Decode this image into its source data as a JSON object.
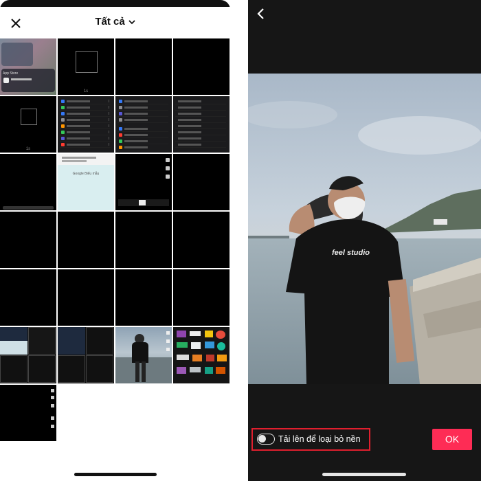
{
  "picker": {
    "title": "Tất cả",
    "close_icon": "close-icon",
    "dropdown_icon": "chevron-down-icon"
  },
  "grid": {
    "cells": [
      {
        "kind": "screenshot-appstore",
        "label": "App Store"
      },
      {
        "kind": "black-square"
      },
      {
        "kind": "black"
      },
      {
        "kind": "black"
      },
      {
        "kind": "black-square"
      },
      {
        "kind": "settings-menu"
      },
      {
        "kind": "settings-menu-2"
      },
      {
        "kind": "settings-menu-3"
      },
      {
        "kind": "black"
      },
      {
        "kind": "google-doc",
        "label": "Google Biểu mẫu"
      },
      {
        "kind": "editor"
      },
      {
        "kind": "black"
      },
      {
        "kind": "black"
      },
      {
        "kind": "black"
      },
      {
        "kind": "black"
      },
      {
        "kind": "black"
      },
      {
        "kind": "black"
      },
      {
        "kind": "black"
      },
      {
        "kind": "black"
      },
      {
        "kind": "black"
      },
      {
        "kind": "collage"
      },
      {
        "kind": "collage-2"
      },
      {
        "kind": "person-photo"
      },
      {
        "kind": "stickers"
      },
      {
        "kind": "black-side-tools"
      }
    ]
  },
  "preview": {
    "back_icon": "chevron-left-icon",
    "toggle_label": "Tải lên để loại bỏ nền",
    "toggle_on": false,
    "ok_label": "OK",
    "shirt_text": "feel studio",
    "accent_color": "#fe2c55",
    "highlight_color": "#e01f2e"
  }
}
